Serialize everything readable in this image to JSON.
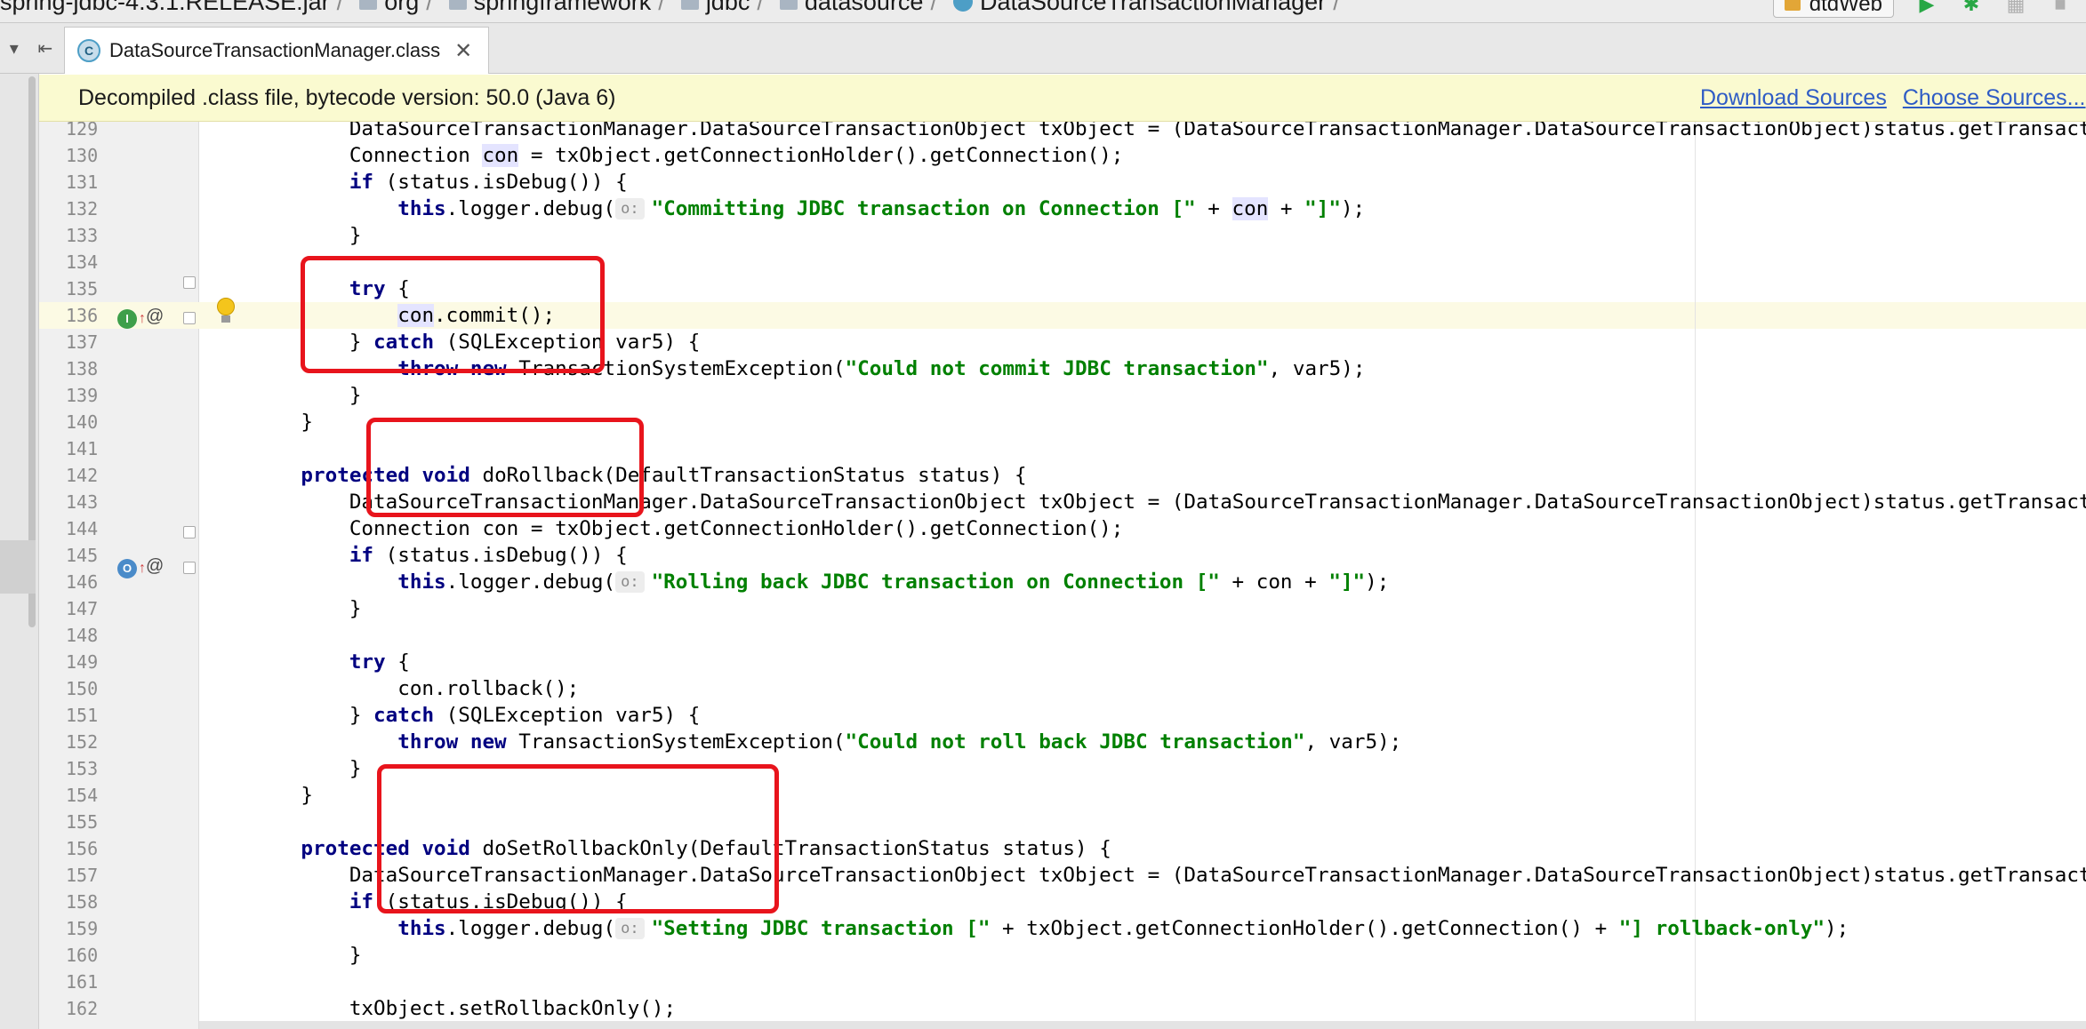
{
  "navbar": {
    "crumbs": [
      {
        "label": "spring-jdbc-4.3.1.RELEASE.jar",
        "icon": "jar-icon"
      },
      {
        "label": "org",
        "icon": "package-icon"
      },
      {
        "label": "springframework",
        "icon": "package-icon"
      },
      {
        "label": "jdbc",
        "icon": "package-icon"
      },
      {
        "label": "datasource",
        "icon": "package-icon"
      },
      {
        "label": "DataSourceTransactionManager",
        "icon": "class-icon"
      }
    ],
    "run_config": "dtdWeb"
  },
  "tab": {
    "label": "DataSourceTransactionManager.class",
    "icon_letter": "C",
    "close": "✕"
  },
  "banner": {
    "text": "Decompiled .class file, bytecode version: 50.0 (Java 6)",
    "download_sources": "Download Sources",
    "choose_sources": "Choose Sources..."
  },
  "code": {
    "lines": [
      {
        "num": "129",
        "segments": [
          {
            "t": "        DataSourceTransactionManager.DataSourceTransactionObject txObject = (DataSourceTransactionManager.DataSourceTransactionObject)status.getTransaction();"
          }
        ]
      },
      {
        "num": "130",
        "segments": [
          {
            "t": "        Connection "
          },
          {
            "t": "con",
            "c": "hl"
          },
          {
            "t": " = txObject.getConnectionHolder().getConnection();"
          }
        ]
      },
      {
        "num": "131",
        "segments": [
          {
            "t": "        "
          },
          {
            "t": "if",
            "c": "kw"
          },
          {
            "t": " (status.isDebug()) {"
          }
        ]
      },
      {
        "num": "132",
        "segments": [
          {
            "t": "            "
          },
          {
            "t": "this",
            "c": "kw"
          },
          {
            "t": ".logger.debug("
          },
          {
            "t": "o:",
            "c": "hint"
          },
          {
            "t": "\"Committing JDBC transaction on Connection [\"",
            "c": "str"
          },
          {
            "t": " + "
          },
          {
            "t": "con",
            "c": "hl"
          },
          {
            "t": " + "
          },
          {
            "t": "\"]\"",
            "c": "str"
          },
          {
            "t": ");"
          }
        ]
      },
      {
        "num": "133",
        "segments": [
          {
            "t": "        }"
          }
        ]
      },
      {
        "num": "134",
        "segments": []
      },
      {
        "num": "135",
        "segments": [
          {
            "t": "        "
          },
          {
            "t": "try",
            "c": "kw"
          },
          {
            "t": " {"
          }
        ]
      },
      {
        "num": "136",
        "segments": [
          {
            "t": "            "
          },
          {
            "t": "con",
            "c": "hl"
          },
          {
            "t": ".commit();"
          }
        ]
      },
      {
        "num": "137",
        "segments": [
          {
            "t": "        } "
          },
          {
            "t": "catch",
            "c": "kw"
          },
          {
            "t": " (SQLException var5) {"
          }
        ]
      },
      {
        "num": "138",
        "segments": [
          {
            "t": "            "
          },
          {
            "t": "throw new",
            "c": "kw"
          },
          {
            "t": " TransactionSystemException("
          },
          {
            "t": "\"Could not commit JDBC transaction\"",
            "c": "str"
          },
          {
            "t": ", var5);"
          }
        ]
      },
      {
        "num": "139",
        "segments": [
          {
            "t": "        }"
          }
        ]
      },
      {
        "num": "140",
        "segments": [
          {
            "t": "    }"
          }
        ]
      },
      {
        "num": "141",
        "segments": []
      },
      {
        "num": "142",
        "segments": [
          {
            "t": "    "
          },
          {
            "t": "protected void",
            "c": "kw"
          },
          {
            "t": " doRollback(DefaultTransactionStatus status) {"
          }
        ]
      },
      {
        "num": "143",
        "segments": [
          {
            "t": "        DataSourceTransactionManager.DataSourceTransactionObject txObject = (DataSourceTransactionManager.DataSourceTransactionObject)status.getTransaction();"
          }
        ]
      },
      {
        "num": "144",
        "segments": [
          {
            "t": "        Connection con = txObject.getConnectionHolder().getConnection();"
          }
        ]
      },
      {
        "num": "145",
        "segments": [
          {
            "t": "        "
          },
          {
            "t": "if",
            "c": "kw"
          },
          {
            "t": " (status.isDebug()) {"
          }
        ]
      },
      {
        "num": "146",
        "segments": [
          {
            "t": "            "
          },
          {
            "t": "this",
            "c": "kw"
          },
          {
            "t": ".logger.debug("
          },
          {
            "t": "o:",
            "c": "hint"
          },
          {
            "t": "\"Rolling back JDBC transaction on Connection [\"",
            "c": "str"
          },
          {
            "t": " + con + "
          },
          {
            "t": "\"]\"",
            "c": "str"
          },
          {
            "t": ");"
          }
        ]
      },
      {
        "num": "147",
        "segments": [
          {
            "t": "        }"
          }
        ]
      },
      {
        "num": "148",
        "segments": []
      },
      {
        "num": "149",
        "segments": [
          {
            "t": "        "
          },
          {
            "t": "try",
            "c": "kw"
          },
          {
            "t": " {"
          }
        ]
      },
      {
        "num": "150",
        "segments": [
          {
            "t": "            con.rollback();"
          }
        ]
      },
      {
        "num": "151",
        "segments": [
          {
            "t": "        } "
          },
          {
            "t": "catch",
            "c": "kw"
          },
          {
            "t": " (SQLException var5) {"
          }
        ]
      },
      {
        "num": "152",
        "segments": [
          {
            "t": "            "
          },
          {
            "t": "throw new",
            "c": "kw"
          },
          {
            "t": " TransactionSystemException("
          },
          {
            "t": "\"Could not roll back JDBC transaction\"",
            "c": "str"
          },
          {
            "t": ", var5);"
          }
        ]
      },
      {
        "num": "153",
        "segments": [
          {
            "t": "        }"
          }
        ]
      },
      {
        "num": "154",
        "segments": [
          {
            "t": "    }"
          }
        ]
      },
      {
        "num": "155",
        "segments": []
      },
      {
        "num": "156",
        "segments": [
          {
            "t": "    "
          },
          {
            "t": "protected void",
            "c": "kw"
          },
          {
            "t": " doSetRollbackOnly(DefaultTransactionStatus status) {"
          }
        ]
      },
      {
        "num": "157",
        "segments": [
          {
            "t": "        DataSourceTransactionManager.DataSourceTransactionObject txObject = (DataSourceTransactionManager.DataSourceTransactionObject)status.getTransaction();"
          }
        ]
      },
      {
        "num": "158",
        "segments": [
          {
            "t": "        "
          },
          {
            "t": "if",
            "c": "kw"
          },
          {
            "t": " (status.isDebug()) {"
          }
        ]
      },
      {
        "num": "159",
        "segments": [
          {
            "t": "            "
          },
          {
            "t": "this",
            "c": "kw"
          },
          {
            "t": ".logger.debug("
          },
          {
            "t": "o:",
            "c": "hint"
          },
          {
            "t": "\"Setting JDBC transaction [\"",
            "c": "str"
          },
          {
            "t": " + txObject.getConnectionHolder().getConnection() + "
          },
          {
            "t": "\"] rollback-only\"",
            "c": "str"
          },
          {
            "t": ");"
          }
        ]
      },
      {
        "num": "160",
        "segments": [
          {
            "t": "        }"
          }
        ]
      },
      {
        "num": "161",
        "segments": []
      },
      {
        "num": "162",
        "segments": [
          {
            "t": "        txObject.setRollbackOnly();"
          }
        ]
      }
    ]
  },
  "gutter_markers": {
    "line_142": {
      "impl": "I",
      "override": "↑",
      "annotation": "@"
    },
    "line_156": {
      "impl": "O",
      "override": "↑",
      "annotation": "@"
    }
  },
  "colors": {
    "keyword": "#000080",
    "string": "#008000",
    "annotation_box": "#e8141c",
    "banner_bg": "#fafad0",
    "link": "#2f5cc5"
  }
}
